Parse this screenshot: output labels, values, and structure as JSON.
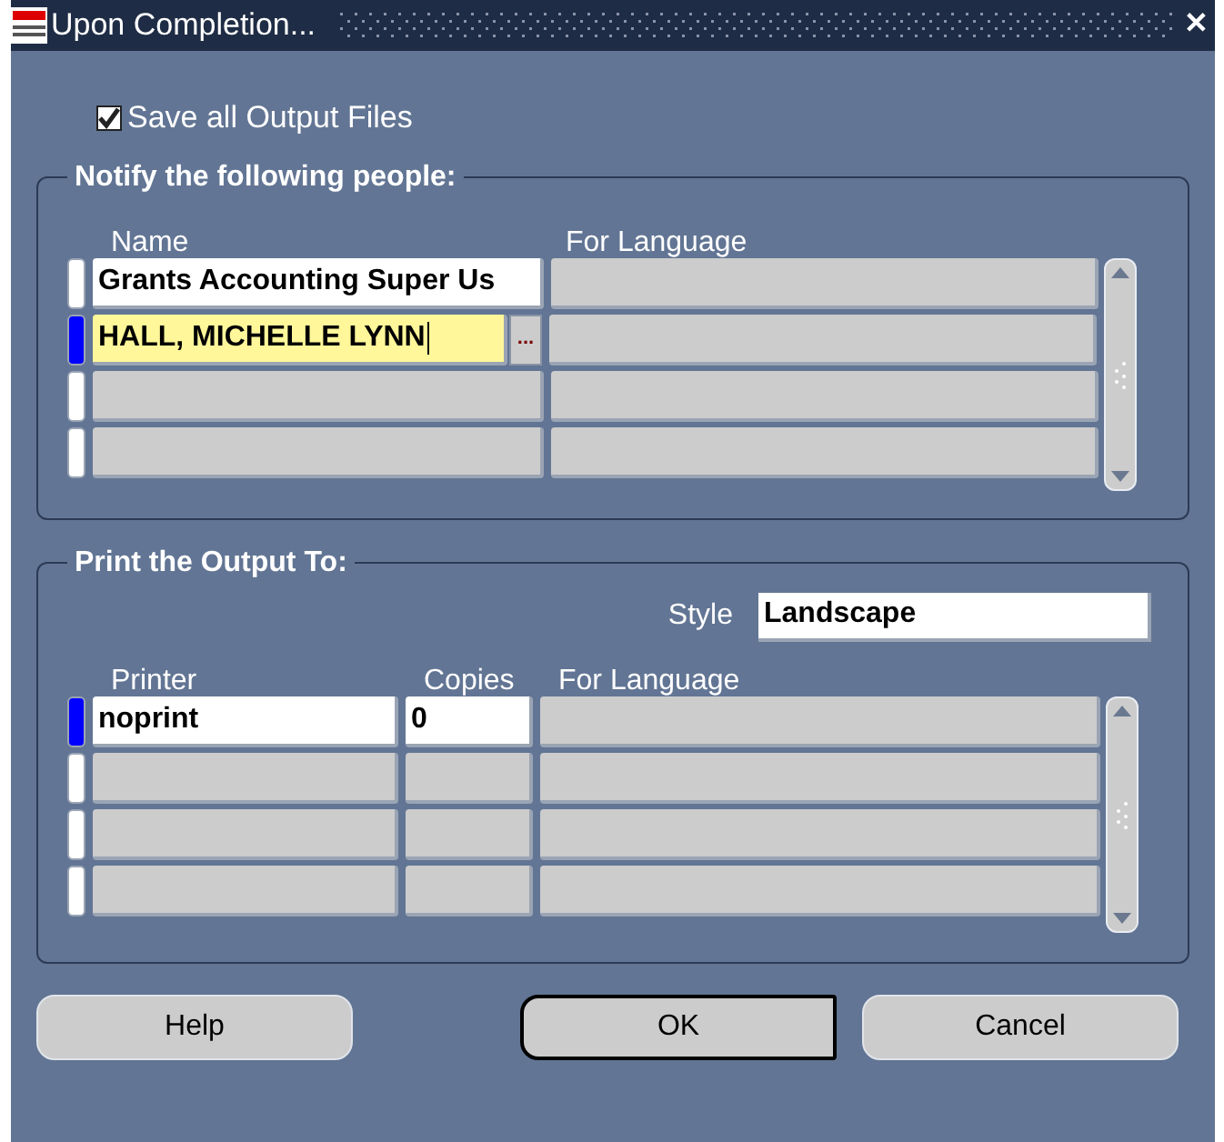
{
  "window": {
    "title": "Upon Completion...",
    "close": "✕"
  },
  "save_all_output_files": {
    "label": "Save all Output Files",
    "checked": true
  },
  "notify": {
    "title": "Notify the following people:",
    "columns": [
      "Name",
      "For Language"
    ],
    "rows": [
      {
        "name": "Grants Accounting Super Us",
        "selected": false,
        "editing": false
      },
      {
        "name": "HALL, MICHELLE LYNN",
        "selected": true,
        "editing": true,
        "lov_button": "..."
      },
      {
        "selected": false,
        "editing": false
      },
      {
        "selected": false,
        "editing": false
      }
    ]
  },
  "print": {
    "title": "Print the Output To:",
    "style_label": "Style",
    "style_value": "Landscape",
    "columns": [
      "Printer",
      "Copies",
      "For Language"
    ],
    "rows": [
      {
        "printer": "noprint",
        "copies": "0",
        "selected": true
      },
      {
        "selected": false
      },
      {
        "selected": false
      },
      {
        "selected": false
      }
    ]
  },
  "buttons": [
    {
      "label": "Help",
      "default": false
    },
    {
      "label": "OK",
      "default": true
    },
    {
      "label": "Cancel",
      "default": false
    }
  ]
}
